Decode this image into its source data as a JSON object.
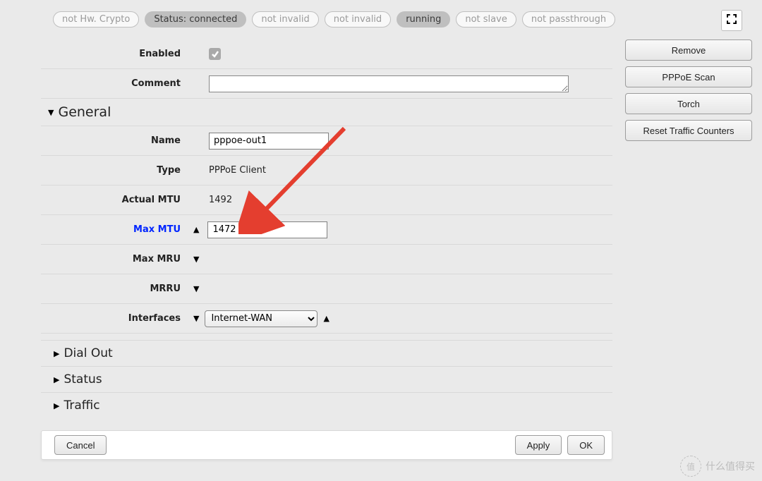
{
  "pills": {
    "hw_crypto": "not Hw. Crypto",
    "status": "Status: connected",
    "invalid1": "not invalid",
    "invalid2": "not invalid",
    "running": "running",
    "slave": "not slave",
    "passthrough": "not passthrough"
  },
  "side": {
    "remove": "Remove",
    "pppoe_scan": "PPPoE Scan",
    "torch": "Torch",
    "reset_tc": "Reset Traffic Counters"
  },
  "labels": {
    "enabled": "Enabled",
    "comment": "Comment",
    "name": "Name",
    "type": "Type",
    "actual_mtu": "Actual MTU",
    "max_mtu": "Max MTU",
    "max_mru": "Max MRU",
    "mrru": "MRRU",
    "interfaces": "Interfaces"
  },
  "sections": {
    "general": "General",
    "dial_out": "Dial Out",
    "status": "Status",
    "traffic": "Traffic"
  },
  "values": {
    "enabled_checked": true,
    "comment": "",
    "name": "pppoe-out1",
    "type": "PPPoE Client",
    "actual_mtu": "1492",
    "max_mtu": "1472",
    "interface": "Internet-WAN"
  },
  "footer": {
    "cancel": "Cancel",
    "apply": "Apply",
    "ok": "OK"
  },
  "watermark": {
    "inner": "值",
    "text": "什么值得买"
  }
}
